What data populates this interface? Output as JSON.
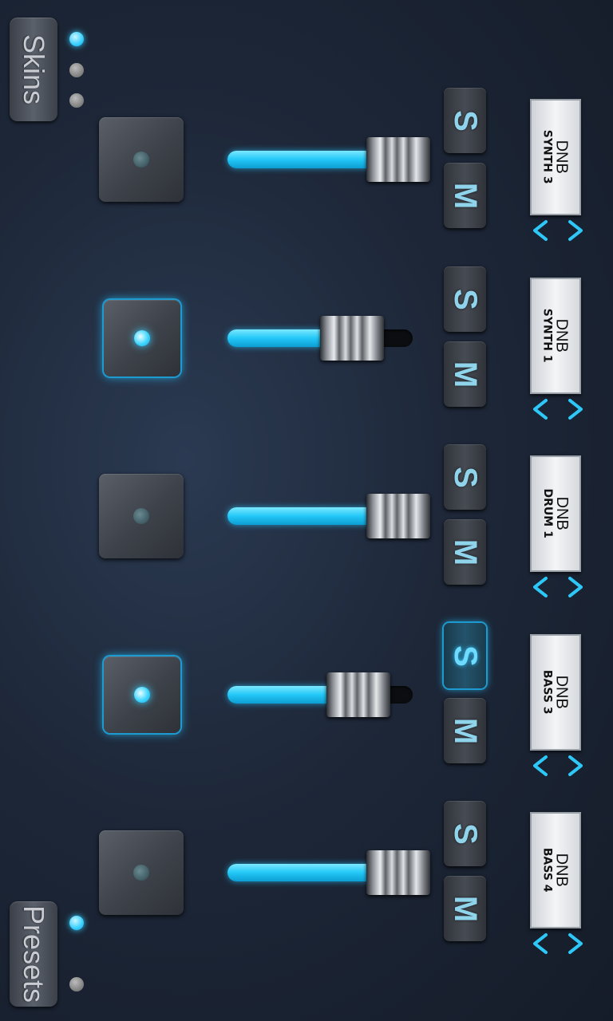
{
  "nav": {
    "skins_label": "Skins",
    "presets_label": "Presets"
  },
  "pager_top": {
    "count": 3,
    "active_index": 0
  },
  "pager_bottom": {
    "count": 2,
    "active_index": 0
  },
  "accent_color": "#2ec8f8",
  "channels": [
    {
      "line1": "DNB",
      "line2": "SYNTH 3",
      "solo_label": "S",
      "mute_label": "M",
      "solo_on": false,
      "pad_on": false,
      "level": 1.0
    },
    {
      "line1": "DNB",
      "line2": "SYNTH 1",
      "solo_label": "S",
      "mute_label": "M",
      "solo_on": false,
      "pad_on": true,
      "level": 0.5
    },
    {
      "line1": "DNB",
      "line2": "DRUM 1",
      "solo_label": "S",
      "mute_label": "M",
      "solo_on": false,
      "pad_on": false,
      "level": 1.0
    },
    {
      "line1": "DNB",
      "line2": "BASS 3",
      "solo_label": "S",
      "mute_label": "M",
      "solo_on": true,
      "pad_on": true,
      "level": 0.57
    },
    {
      "line1": "DNB",
      "line2": "BASS 4",
      "solo_label": "S",
      "mute_label": "M",
      "solo_on": false,
      "pad_on": false,
      "level": 1.0
    }
  ],
  "icons": {
    "prev": "chevron-left-icon",
    "next": "chevron-right-icon"
  }
}
